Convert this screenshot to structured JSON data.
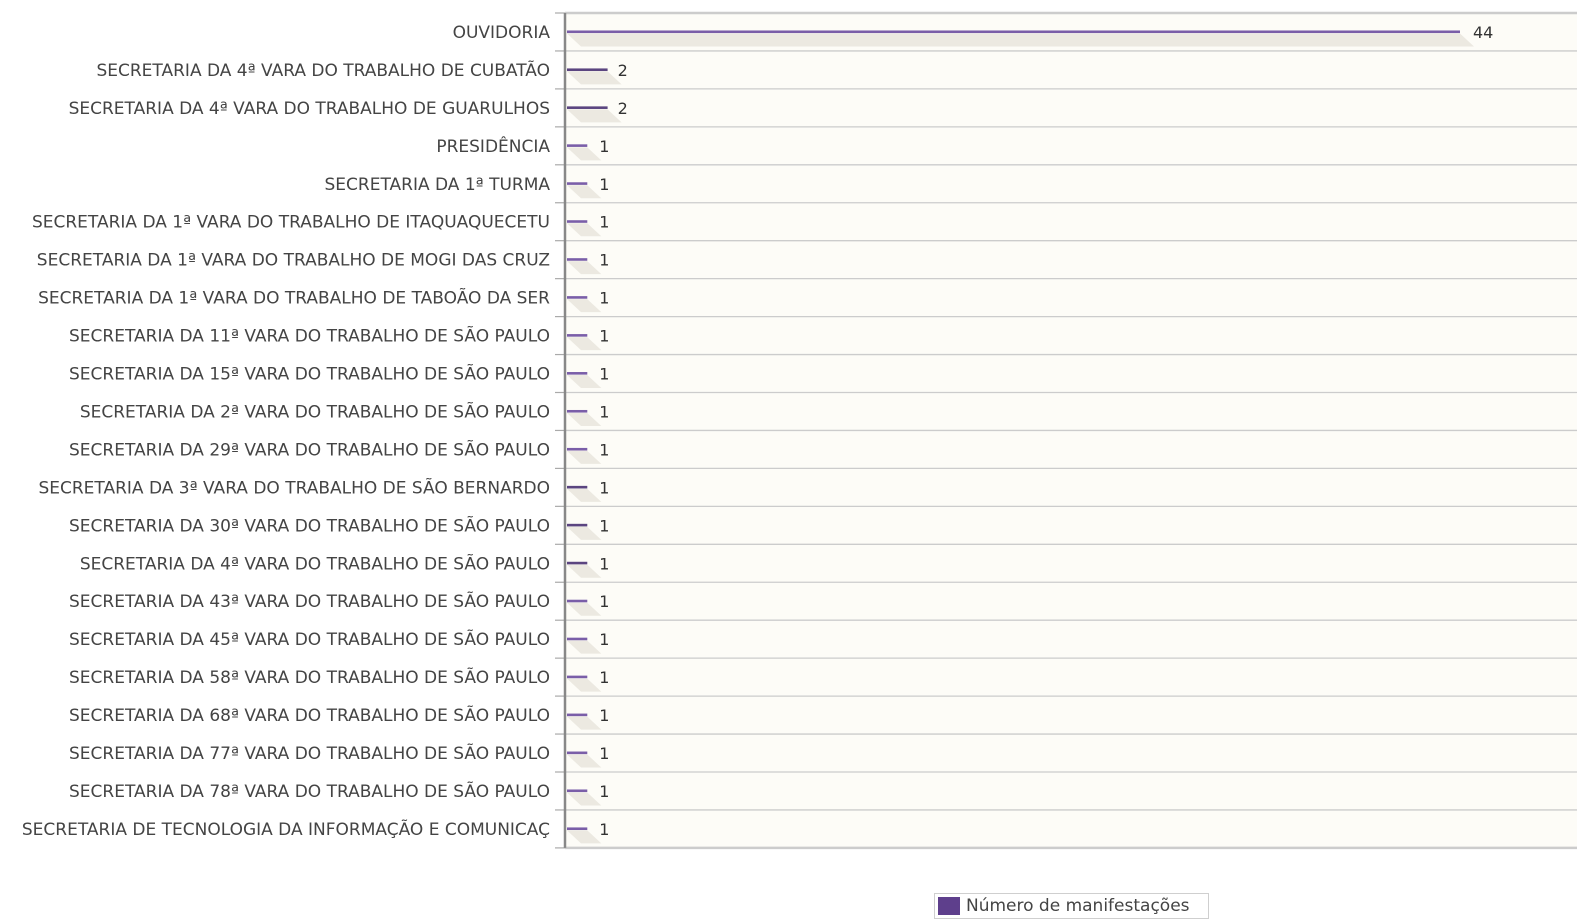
{
  "chart_data": {
    "type": "bar",
    "orientation": "horizontal",
    "categories": [
      "OUVIDORIA",
      "SECRETARIA DA 4ª VARA DO TRABALHO DE CUBATÃO",
      "SECRETARIA DA 4ª VARA DO TRABALHO DE GUARULHOS",
      "PRESIDÊNCIA",
      "SECRETARIA DA 1ª TURMA",
      "SECRETARIA DA 1ª VARA DO TRABALHO DE ITAQUAQUECETU",
      "SECRETARIA DA 1ª VARA DO TRABALHO DE MOGI DAS CRUZ",
      "SECRETARIA DA 1ª VARA DO TRABALHO DE TABOÃO DA SER",
      "SECRETARIA DA 11ª VARA DO TRABALHO DE SÃO PAULO",
      "SECRETARIA DA 15ª VARA DO TRABALHO DE SÃO PAULO",
      "SECRETARIA DA 2ª VARA DO TRABALHO DE SÃO PAULO",
      "SECRETARIA DA 29ª VARA DO TRABALHO DE SÃO PAULO",
      "SECRETARIA DA 3ª VARA DO TRABALHO DE SÃO BERNARDO",
      "SECRETARIA DA 30ª VARA DO TRABALHO DE SÃO PAULO",
      "SECRETARIA DA 4ª VARA DO TRABALHO DE SÃO PAULO",
      "SECRETARIA DA 43ª VARA DO TRABALHO DE SÃO PAULO",
      "SECRETARIA DA 45ª VARA DO TRABALHO DE SÃO PAULO",
      "SECRETARIA DA 58ª VARA DO TRABALHO DE SÃO PAULO",
      "SECRETARIA DA 68ª VARA DO TRABALHO DE SÃO PAULO",
      "SECRETARIA DA 77ª VARA DO TRABALHO DE SÃO PAULO",
      "SECRETARIA DA 78ª VARA DO TRABALHO DE SÃO PAULO",
      "SECRETARIA DE TECNOLOGIA DA INFORMAÇÃO E COMUNICAÇ"
    ],
    "series": [
      {
        "name": "Número de manifestações",
        "values": [
          44,
          2,
          2,
          1,
          1,
          1,
          1,
          1,
          1,
          1,
          1,
          1,
          1,
          1,
          1,
          1,
          1,
          1,
          1,
          1,
          1,
          1
        ]
      }
    ],
    "xlim": [
      0,
      44
    ],
    "grid": true,
    "legend_position": "bottom",
    "colors": {
      "bar": "#7a5ea8",
      "bar_dark": "#5b4580",
      "legend_swatch": "#5e3f8c",
      "plot_background": "#fdfcf7",
      "grid": "#cccccc",
      "axis": "#888888"
    }
  }
}
